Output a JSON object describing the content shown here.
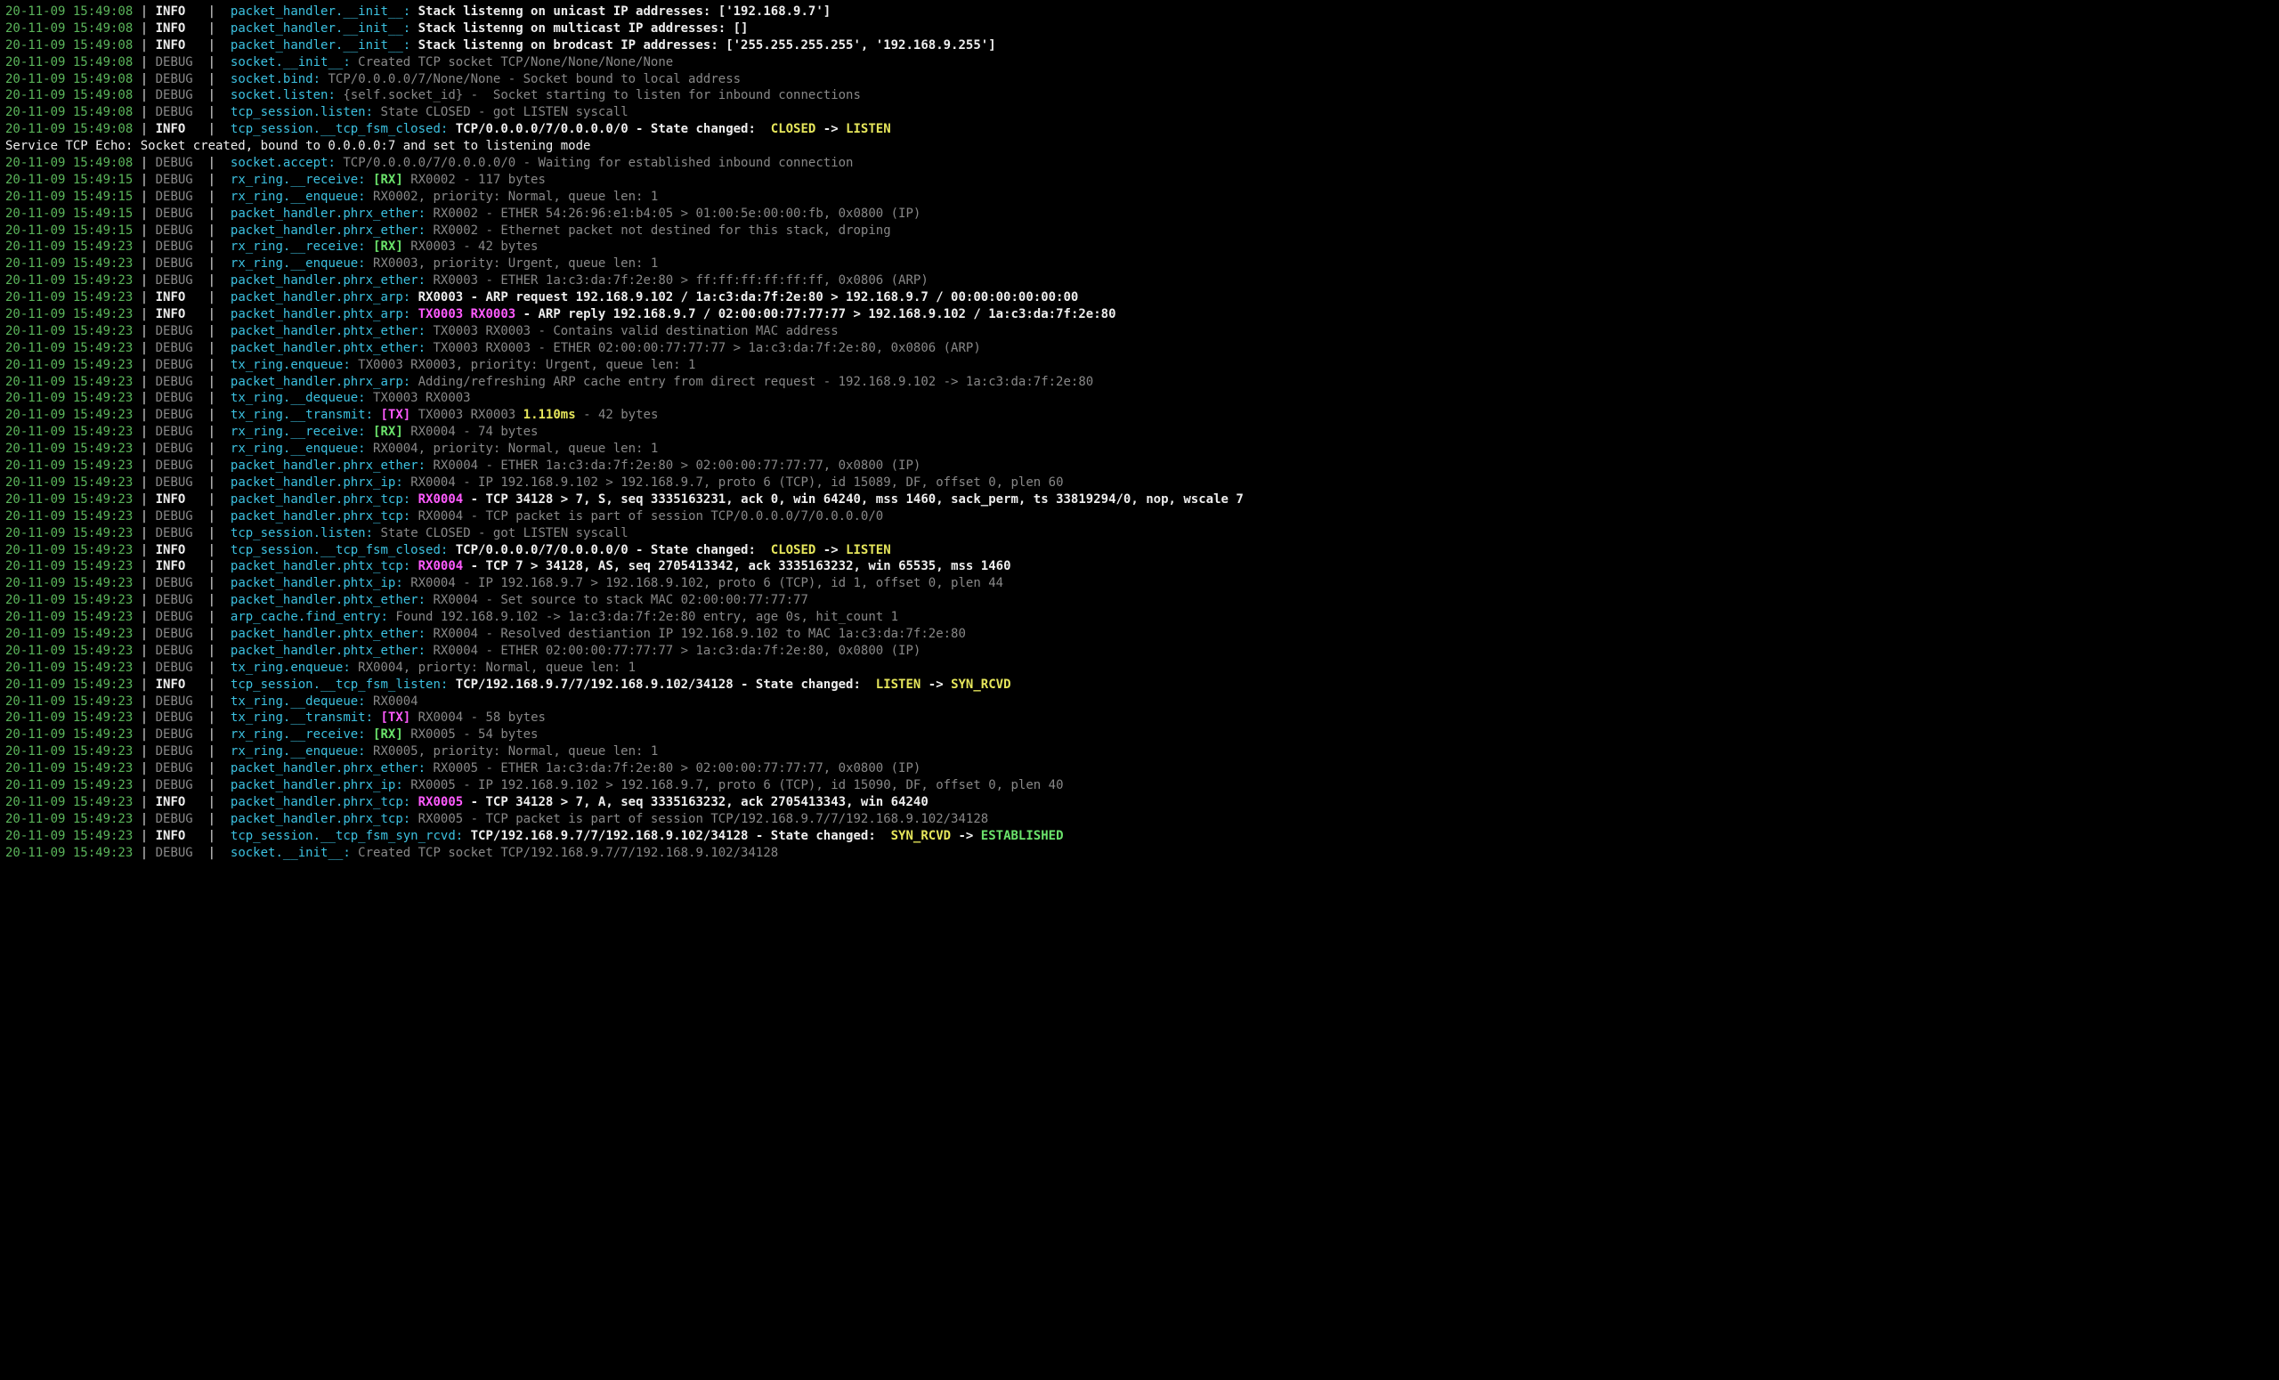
{
  "columns": {
    "ts_width_ch": 17,
    "lvl_width_ch": 6
  },
  "lines": [
    {
      "ts": "20-11-09 15:49:08",
      "lvl": "INFO",
      "src": "packet_handler.__init__:",
      "segs": [
        {
          "t": " Stack listenng on unicast IP addresses: ['192.168.9.7']",
          "c": "msg-info"
        }
      ]
    },
    {
      "ts": "20-11-09 15:49:08",
      "lvl": "INFO",
      "src": "packet_handler.__init__:",
      "segs": [
        {
          "t": " Stack listenng on multicast IP addresses: []",
          "c": "msg-info"
        }
      ]
    },
    {
      "ts": "20-11-09 15:49:08",
      "lvl": "INFO",
      "src": "packet_handler.__init__:",
      "segs": [
        {
          "t": " Stack listenng on brodcast IP addresses: ['255.255.255.255', '192.168.9.255']",
          "c": "msg-info"
        }
      ]
    },
    {
      "ts": "20-11-09 15:49:08",
      "lvl": "DEBUG",
      "src": "socket.__init__:",
      "segs": [
        {
          "t": " Created TCP socket TCP/None/None/None/None",
          "c": "msg-debug"
        }
      ]
    },
    {
      "ts": "20-11-09 15:49:08",
      "lvl": "DEBUG",
      "src": "socket.bind:",
      "segs": [
        {
          "t": " TCP/0.0.0.0/7/None/None - Socket bound to local address",
          "c": "msg-debug"
        }
      ]
    },
    {
      "ts": "20-11-09 15:49:08",
      "lvl": "DEBUG",
      "src": "socket.listen:",
      "segs": [
        {
          "t": " {self.socket_id} -  Socket starting to listen for inbound connections",
          "c": "msg-debug"
        }
      ]
    },
    {
      "ts": "20-11-09 15:49:08",
      "lvl": "DEBUG",
      "src": "tcp_session.listen:",
      "segs": [
        {
          "t": " State CLOSED - got LISTEN syscall",
          "c": "msg-debug"
        }
      ]
    },
    {
      "ts": "20-11-09 15:49:08",
      "lvl": "INFO",
      "src": "tcp_session.__tcp_fsm_closed:",
      "segs": [
        {
          "t": " TCP/0.0.0.0/7/0.0.0.0/0 - State changed:  ",
          "c": "msg-info"
        },
        {
          "t": "CLOSED",
          "c": "stY"
        },
        {
          "t": " -> ",
          "c": "msg-info"
        },
        {
          "t": "LISTEN",
          "c": "stY"
        }
      ]
    },
    {
      "free": "Service TCP Echo: Socket created, bound to 0.0.0.0:7 and set to listening mode"
    },
    {
      "ts": "20-11-09 15:49:08",
      "lvl": "DEBUG",
      "src": "socket.accept:",
      "segs": [
        {
          "t": " TCP/0.0.0.0/7/0.0.0.0/0 - Waiting for established inbound connection",
          "c": "msg-debug"
        }
      ]
    },
    {
      "ts": "20-11-09 15:49:15",
      "lvl": "DEBUG",
      "src": "rx_ring.__receive:",
      "segs": [
        {
          "t": " ",
          "c": "msg-debug"
        },
        {
          "t": "[RX]",
          "c": "rx"
        },
        {
          "t": " RX0002 - 117 bytes",
          "c": "msg-debug"
        }
      ]
    },
    {
      "ts": "20-11-09 15:49:15",
      "lvl": "DEBUG",
      "src": "rx_ring.__enqueue:",
      "segs": [
        {
          "t": " RX0002, priority: Normal, queue len: 1",
          "c": "msg-debug"
        }
      ]
    },
    {
      "ts": "20-11-09 15:49:15",
      "lvl": "DEBUG",
      "src": "packet_handler.phrx_ether:",
      "segs": [
        {
          "t": " RX0002 - ETHER 54:26:96:e1:b4:05 > 01:00:5e:00:00:fb, 0x0800 (IP)",
          "c": "msg-debug"
        }
      ]
    },
    {
      "ts": "20-11-09 15:49:15",
      "lvl": "DEBUG",
      "src": "packet_handler.phrx_ether:",
      "segs": [
        {
          "t": " RX0002 - Ethernet packet not destined for this stack, droping",
          "c": "msg-debug"
        }
      ]
    },
    {
      "ts": "20-11-09 15:49:23",
      "lvl": "DEBUG",
      "src": "rx_ring.__receive:",
      "segs": [
        {
          "t": " ",
          "c": "msg-debug"
        },
        {
          "t": "[RX]",
          "c": "rx"
        },
        {
          "t": " RX0003 - 42 bytes",
          "c": "msg-debug"
        }
      ]
    },
    {
      "ts": "20-11-09 15:49:23",
      "lvl": "DEBUG",
      "src": "rx_ring.__enqueue:",
      "segs": [
        {
          "t": " RX0003, priority: Urgent, queue len: 1",
          "c": "msg-debug"
        }
      ]
    },
    {
      "ts": "20-11-09 15:49:23",
      "lvl": "DEBUG",
      "src": "packet_handler.phrx_ether:",
      "segs": [
        {
          "t": " RX0003 - ETHER 1a:c3:da:7f:2e:80 > ff:ff:ff:ff:ff:ff, 0x0806 (ARP)",
          "c": "msg-debug"
        }
      ]
    },
    {
      "ts": "20-11-09 15:49:23",
      "lvl": "INFO",
      "src": "packet_handler.phrx_arp:",
      "segs": [
        {
          "t": " RX0003 - ARP request 192.168.9.102 / 1a:c3:da:7f:2e:80 > 192.168.9.7 / 00:00:00:00:00:00",
          "c": "msg-info"
        }
      ]
    },
    {
      "ts": "20-11-09 15:49:23",
      "lvl": "INFO",
      "src": "packet_handler.phtx_arp:",
      "segs": [
        {
          "t": " ",
          "c": "msg-info"
        },
        {
          "t": "TX0003",
          "c": "tx"
        },
        {
          "t": " ",
          "c": "msg-info"
        },
        {
          "t": "RX0003",
          "c": "rxid"
        },
        {
          "t": " - ARP reply 192.168.9.7 / 02:00:00:77:77:77 > 192.168.9.102 / 1a:c3:da:7f:2e:80",
          "c": "msg-info"
        }
      ]
    },
    {
      "ts": "20-11-09 15:49:23",
      "lvl": "DEBUG",
      "src": "packet_handler.phtx_ether:",
      "segs": [
        {
          "t": " TX0003 RX0003 - Contains valid destination MAC address",
          "c": "msg-debug"
        }
      ]
    },
    {
      "ts": "20-11-09 15:49:23",
      "lvl": "DEBUG",
      "src": "packet_handler.phtx_ether:",
      "segs": [
        {
          "t": " TX0003 RX0003 - ETHER 02:00:00:77:77:77 > 1a:c3:da:7f:2e:80, 0x0806 (ARP)",
          "c": "msg-debug"
        }
      ]
    },
    {
      "ts": "20-11-09 15:49:23",
      "lvl": "DEBUG",
      "src": "tx_ring.enqueue:",
      "segs": [
        {
          "t": " TX0003 RX0003, priority: Urgent, queue len: 1",
          "c": "msg-debug"
        }
      ]
    },
    {
      "ts": "20-11-09 15:49:23",
      "lvl": "DEBUG",
      "src": "packet_handler.phrx_arp:",
      "segs": [
        {
          "t": " Adding/refreshing ARP cache entry from direct request - 192.168.9.102 -> 1a:c3:da:7f:2e:80",
          "c": "msg-debug"
        }
      ]
    },
    {
      "ts": "20-11-09 15:49:23",
      "lvl": "DEBUG",
      "src": "tx_ring.__dequeue:",
      "segs": [
        {
          "t": " TX0003 RX0003",
          "c": "msg-debug"
        }
      ]
    },
    {
      "ts": "20-11-09 15:49:23",
      "lvl": "DEBUG",
      "src": "tx_ring.__transmit:",
      "segs": [
        {
          "t": " ",
          "c": "msg-debug"
        },
        {
          "t": "[TX]",
          "c": "tx"
        },
        {
          "t": " TX0003 RX0003 ",
          "c": "msg-debug"
        },
        {
          "t": "1.110ms",
          "c": "durY"
        },
        {
          "t": " - 42 bytes",
          "c": "msg-debug"
        }
      ]
    },
    {
      "ts": "20-11-09 15:49:23",
      "lvl": "DEBUG",
      "src": "rx_ring.__receive:",
      "segs": [
        {
          "t": " ",
          "c": "msg-debug"
        },
        {
          "t": "[RX]",
          "c": "rx"
        },
        {
          "t": " RX0004 - 74 bytes",
          "c": "msg-debug"
        }
      ]
    },
    {
      "ts": "20-11-09 15:49:23",
      "lvl": "DEBUG",
      "src": "rx_ring.__enqueue:",
      "segs": [
        {
          "t": " RX0004, priority: Normal, queue len: 1",
          "c": "msg-debug"
        }
      ]
    },
    {
      "ts": "20-11-09 15:49:23",
      "lvl": "DEBUG",
      "src": "packet_handler.phrx_ether:",
      "segs": [
        {
          "t": " RX0004 - ETHER 1a:c3:da:7f:2e:80 > 02:00:00:77:77:77, 0x0800 (IP)",
          "c": "msg-debug"
        }
      ]
    },
    {
      "ts": "20-11-09 15:49:23",
      "lvl": "DEBUG",
      "src": "packet_handler.phrx_ip:",
      "segs": [
        {
          "t": " RX0004 - IP 192.168.9.102 > 192.168.9.7, proto 6 (TCP), id 15089, DF, offset 0, plen 60",
          "c": "msg-debug"
        }
      ]
    },
    {
      "ts": "20-11-09 15:49:23",
      "lvl": "INFO",
      "src": "packet_handler.phrx_tcp:",
      "segs": [
        {
          "t": " ",
          "c": "msg-info"
        },
        {
          "t": "RX0004",
          "c": "rxid"
        },
        {
          "t": " - TCP 34128 > 7, S, seq 3335163231, ack 0, win 64240, mss 1460, sack_perm, ts 33819294/0, nop, wscale 7",
          "c": "msg-info"
        }
      ]
    },
    {
      "ts": "20-11-09 15:49:23",
      "lvl": "DEBUG",
      "src": "packet_handler.phrx_tcp:",
      "segs": [
        {
          "t": " RX0004 - TCP packet is part of session TCP/0.0.0.0/7/0.0.0.0/0",
          "c": "msg-debug"
        }
      ]
    },
    {
      "ts": "20-11-09 15:49:23",
      "lvl": "DEBUG",
      "src": "tcp_session.listen:",
      "segs": [
        {
          "t": " State CLOSED - got LISTEN syscall",
          "c": "msg-debug"
        }
      ]
    },
    {
      "ts": "20-11-09 15:49:23",
      "lvl": "INFO",
      "src": "tcp_session.__tcp_fsm_closed:",
      "segs": [
        {
          "t": " TCP/0.0.0.0/7/0.0.0.0/0 - State changed:  ",
          "c": "msg-info"
        },
        {
          "t": "CLOSED",
          "c": "stY"
        },
        {
          "t": " -> ",
          "c": "msg-info"
        },
        {
          "t": "LISTEN",
          "c": "stY"
        }
      ]
    },
    {
      "ts": "20-11-09 15:49:23",
      "lvl": "INFO",
      "src": "packet_handler.phtx_tcp:",
      "segs": [
        {
          "t": " ",
          "c": "msg-info"
        },
        {
          "t": "RX0004",
          "c": "rxid"
        },
        {
          "t": " - TCP 7 > 34128, AS, seq 2705413342, ack 3335163232, win 65535, mss 1460",
          "c": "msg-info"
        }
      ]
    },
    {
      "ts": "20-11-09 15:49:23",
      "lvl": "DEBUG",
      "src": "packet_handler.phtx_ip:",
      "segs": [
        {
          "t": " RX0004 - IP 192.168.9.7 > 192.168.9.102, proto 6 (TCP), id 1, offset 0, plen 44",
          "c": "msg-debug"
        }
      ]
    },
    {
      "ts": "20-11-09 15:49:23",
      "lvl": "DEBUG",
      "src": "packet_handler.phtx_ether:",
      "segs": [
        {
          "t": " RX0004 - Set source to stack MAC 02:00:00:77:77:77",
          "c": "msg-debug"
        }
      ]
    },
    {
      "ts": "20-11-09 15:49:23",
      "lvl": "DEBUG",
      "src": "arp_cache.find_entry:",
      "segs": [
        {
          "t": " Found 192.168.9.102 -> 1a:c3:da:7f:2e:80 entry, age 0s, hit_count 1",
          "c": "msg-debug"
        }
      ]
    },
    {
      "ts": "20-11-09 15:49:23",
      "lvl": "DEBUG",
      "src": "packet_handler.phtx_ether:",
      "segs": [
        {
          "t": " RX0004 - Resolved destiantion IP 192.168.9.102 to MAC 1a:c3:da:7f:2e:80",
          "c": "msg-debug"
        }
      ]
    },
    {
      "ts": "20-11-09 15:49:23",
      "lvl": "DEBUG",
      "src": "packet_handler.phtx_ether:",
      "segs": [
        {
          "t": " RX0004 - ETHER 02:00:00:77:77:77 > 1a:c3:da:7f:2e:80, 0x0800 (IP)",
          "c": "msg-debug"
        }
      ]
    },
    {
      "ts": "20-11-09 15:49:23",
      "lvl": "DEBUG",
      "src": "tx_ring.enqueue:",
      "segs": [
        {
          "t": " RX0004, priorty: Normal, queue len: 1",
          "c": "msg-debug"
        }
      ]
    },
    {
      "ts": "20-11-09 15:49:23",
      "lvl": "INFO",
      "src": "tcp_session.__tcp_fsm_listen:",
      "segs": [
        {
          "t": " TCP/192.168.9.7/7/192.168.9.102/34128 - State changed:  ",
          "c": "msg-info"
        },
        {
          "t": "LISTEN",
          "c": "stY"
        },
        {
          "t": " -> ",
          "c": "msg-info"
        },
        {
          "t": "SYN_RCVD",
          "c": "stY"
        }
      ]
    },
    {
      "ts": "20-11-09 15:49:23",
      "lvl": "DEBUG",
      "src": "tx_ring.__dequeue:",
      "segs": [
        {
          "t": " RX0004",
          "c": "msg-debug"
        }
      ]
    },
    {
      "ts": "20-11-09 15:49:23",
      "lvl": "DEBUG",
      "src": "tx_ring.__transmit:",
      "segs": [
        {
          "t": " ",
          "c": "msg-debug"
        },
        {
          "t": "[TX]",
          "c": "tx"
        },
        {
          "t": " RX0004 - 58 bytes",
          "c": "msg-debug"
        }
      ]
    },
    {
      "ts": "20-11-09 15:49:23",
      "lvl": "DEBUG",
      "src": "rx_ring.__receive:",
      "segs": [
        {
          "t": " ",
          "c": "msg-debug"
        },
        {
          "t": "[RX]",
          "c": "rx"
        },
        {
          "t": " RX0005 - 54 bytes",
          "c": "msg-debug"
        }
      ]
    },
    {
      "ts": "20-11-09 15:49:23",
      "lvl": "DEBUG",
      "src": "rx_ring.__enqueue:",
      "segs": [
        {
          "t": " RX0005, priority: Normal, queue len: 1",
          "c": "msg-debug"
        }
      ]
    },
    {
      "ts": "20-11-09 15:49:23",
      "lvl": "DEBUG",
      "src": "packet_handler.phrx_ether:",
      "segs": [
        {
          "t": " RX0005 - ETHER 1a:c3:da:7f:2e:80 > 02:00:00:77:77:77, 0x0800 (IP)",
          "c": "msg-debug"
        }
      ]
    },
    {
      "ts": "20-11-09 15:49:23",
      "lvl": "DEBUG",
      "src": "packet_handler.phrx_ip:",
      "segs": [
        {
          "t": " RX0005 - IP 192.168.9.102 > 192.168.9.7, proto 6 (TCP), id 15090, DF, offset 0, plen 40",
          "c": "msg-debug"
        }
      ]
    },
    {
      "ts": "20-11-09 15:49:23",
      "lvl": "INFO",
      "src": "packet_handler.phrx_tcp:",
      "segs": [
        {
          "t": " ",
          "c": "msg-info"
        },
        {
          "t": "RX0005",
          "c": "rxid"
        },
        {
          "t": " - TCP 34128 > 7, A, seq 3335163232, ack 2705413343, win 64240",
          "c": "msg-info"
        }
      ]
    },
    {
      "ts": "20-11-09 15:49:23",
      "lvl": "DEBUG",
      "src": "packet_handler.phrx_tcp:",
      "segs": [
        {
          "t": " RX0005 - TCP packet is part of session TCP/192.168.9.7/7/192.168.9.102/34128",
          "c": "msg-debug"
        }
      ]
    },
    {
      "ts": "20-11-09 15:49:23",
      "lvl": "INFO",
      "src": "tcp_session.__tcp_fsm_syn_rcvd:",
      "segs": [
        {
          "t": " TCP/192.168.9.7/7/192.168.9.102/34128 - State changed:  ",
          "c": "msg-info"
        },
        {
          "t": "SYN_RCVD",
          "c": "stY"
        },
        {
          "t": " -> ",
          "c": "msg-info"
        },
        {
          "t": "ESTABLISHED",
          "c": "stG"
        }
      ]
    },
    {
      "ts": "20-11-09 15:49:23",
      "lvl": "DEBUG",
      "src": "socket.__init__:",
      "segs": [
        {
          "t": " Created TCP socket TCP/192.168.9.7/7/192.168.9.102/34128",
          "c": "msg-debug"
        }
      ]
    }
  ]
}
